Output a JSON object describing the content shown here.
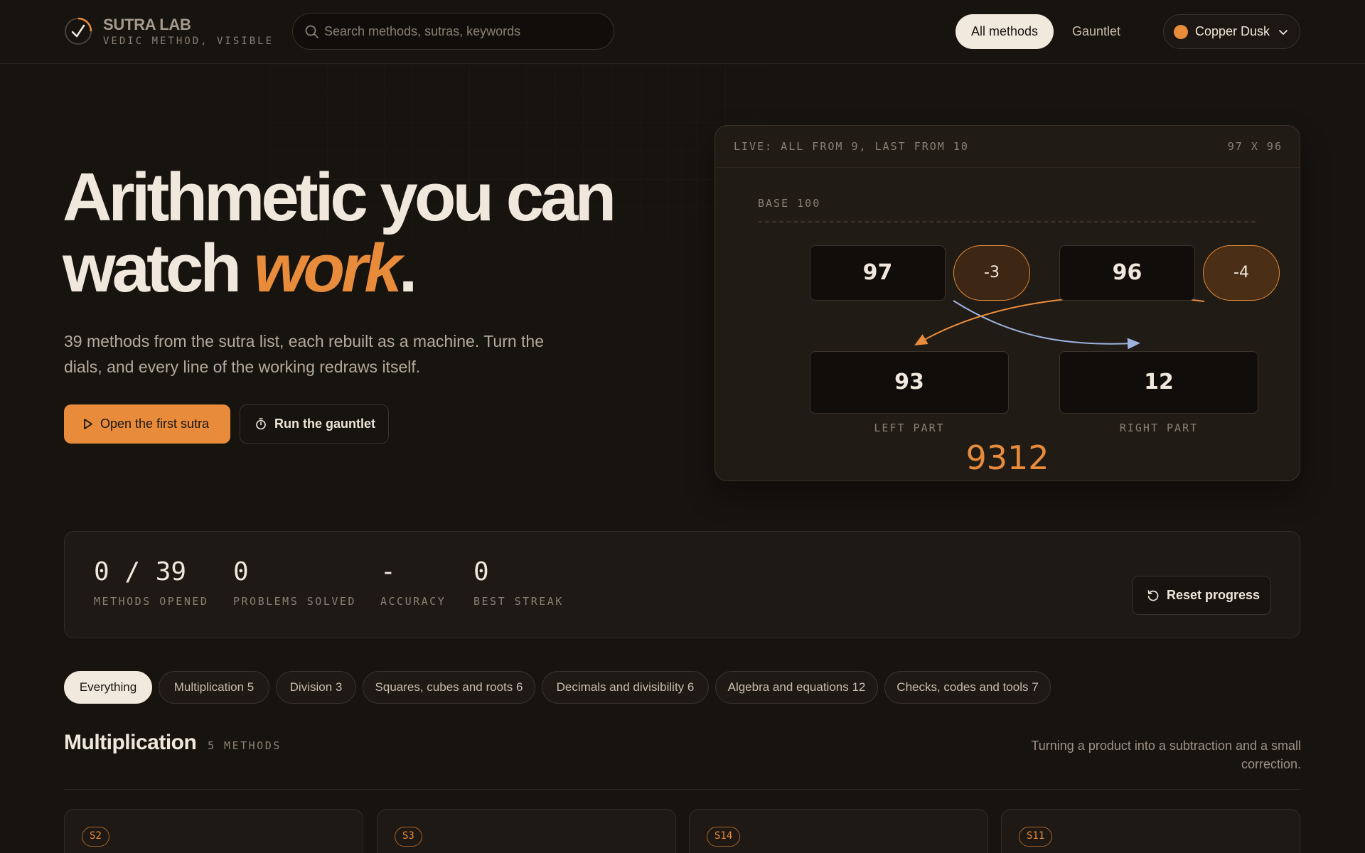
{
  "brand": {
    "title": "SUTRA LAB",
    "subtitle": "VEDIC METHOD, VISIBLE"
  },
  "search": {
    "placeholder": "Search methods, sutras, keywords",
    "value": ""
  },
  "nav": {
    "all_methods": "All methods",
    "gauntlet": "Gauntlet"
  },
  "theme": {
    "label": "Copper Dusk",
    "color": "#e88c3c"
  },
  "hero": {
    "title_line1": "Arithmetic you can",
    "title_line2_start": "watch",
    "title_accent": "work",
    "title_end": ".",
    "subtitle": "39 methods from the sutra list, each rebuilt as a machine. Turn the dials, and every line of the working redraws itself.",
    "primary_button": "Open the first sutra",
    "secondary_button": "Run the gauntlet"
  },
  "demo": {
    "header_left": "LIVE: ALL FROM 9, LAST FROM 10",
    "header_right": "97 X 96",
    "base_label": "BASE 100",
    "a": "97",
    "a_dev": "-3",
    "b": "96",
    "b_dev": "-4",
    "left_part": "93",
    "right_part": "12",
    "left_label": "LEFT PART",
    "right_label": "RIGHT PART",
    "result": "9312"
  },
  "stats": {
    "items": [
      {
        "value": "0 / 39",
        "label": "METHODS OPENED"
      },
      {
        "value": "0",
        "label": "PROBLEMS SOLVED"
      },
      {
        "value": "-",
        "label": "ACCURACY"
      },
      {
        "value": "0",
        "label": "BEST STREAK"
      }
    ],
    "reset_button": "Reset progress"
  },
  "filters": [
    {
      "label": "Everything"
    },
    {
      "label": "Multiplication 5"
    },
    {
      "label": "Division 3"
    },
    {
      "label": "Squares, cubes and roots 6"
    },
    {
      "label": "Decimals and divisibility 6"
    },
    {
      "label": "Algebra and equations 12"
    },
    {
      "label": "Checks, codes and tools 7"
    }
  ],
  "section": {
    "title": "Multiplication",
    "count": "5 METHODS",
    "description": "Turning a product into a subtraction and a small correction."
  },
  "cards": [
    {
      "tag": "S2"
    },
    {
      "tag": "S3"
    },
    {
      "tag": "S14"
    },
    {
      "tag": "S11"
    }
  ],
  "colors": {
    "accent": "#e88c3c",
    "background": "#17130f",
    "arrow_blue": "#9db4e0"
  }
}
